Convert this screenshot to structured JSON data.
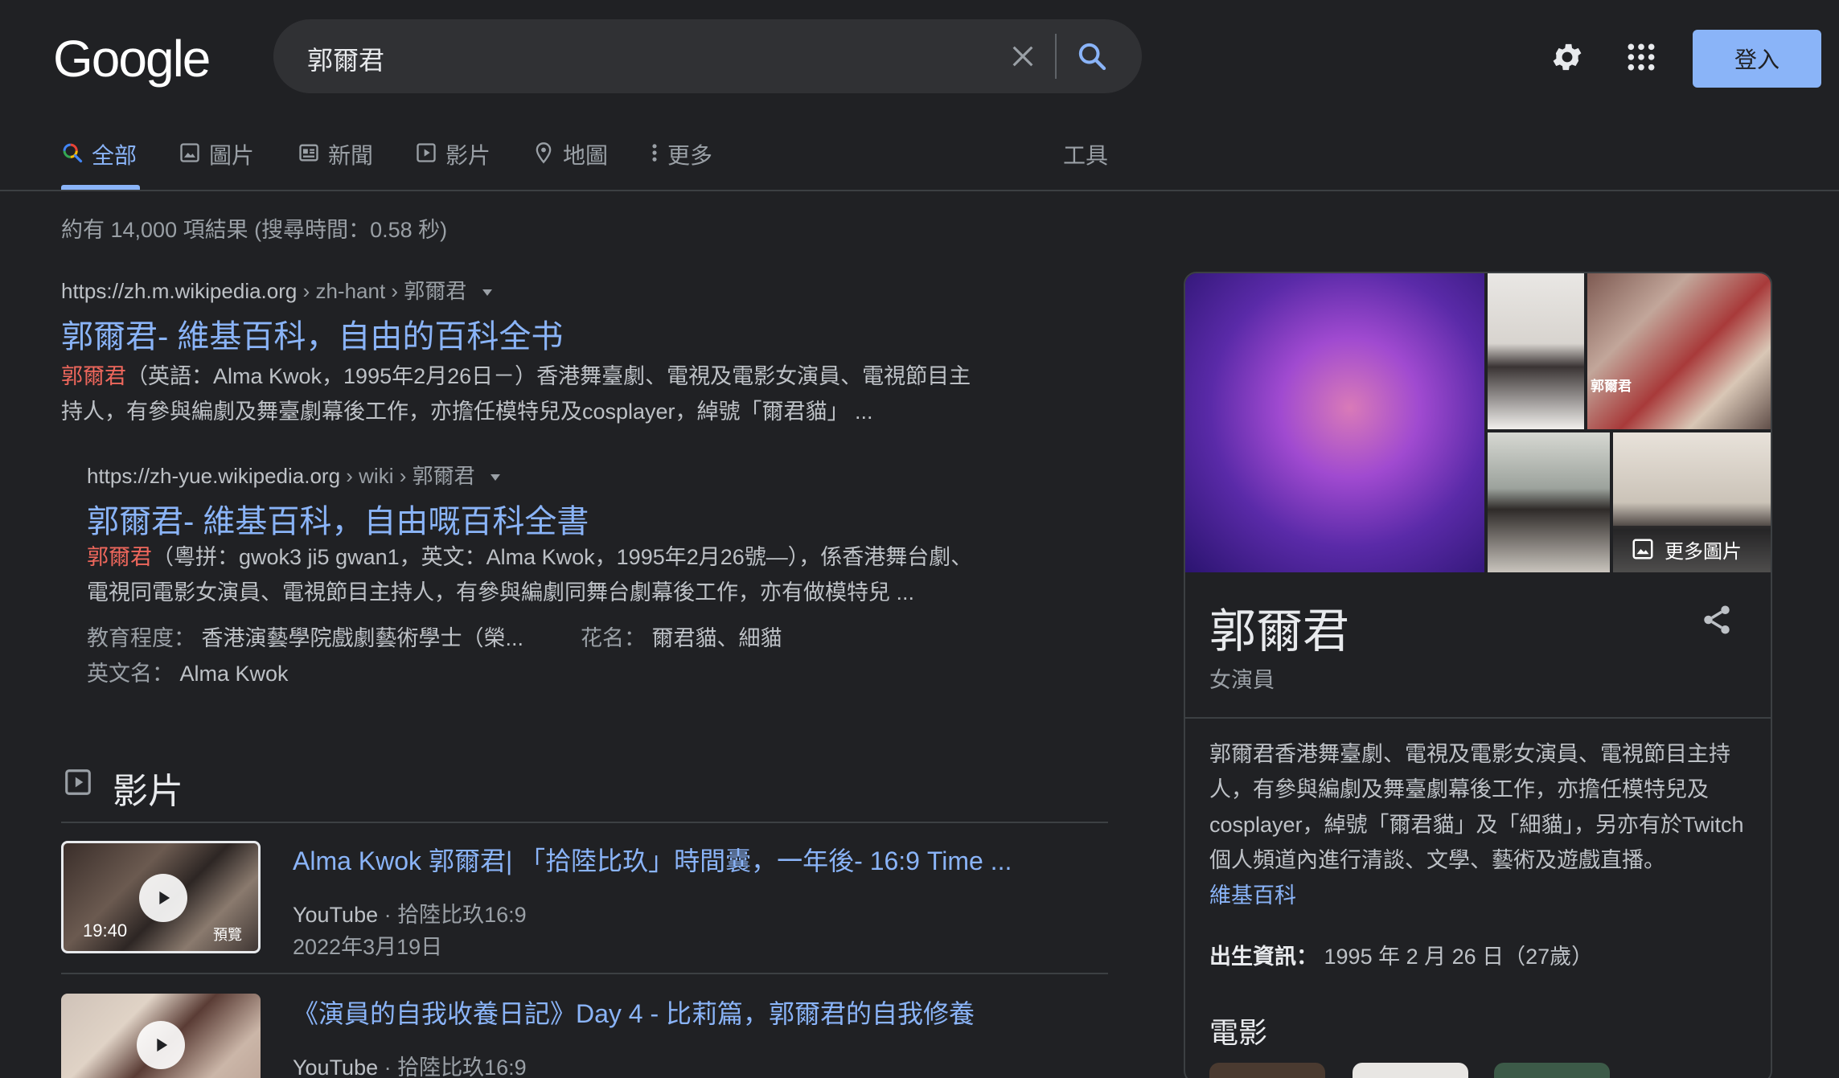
{
  "header": {
    "logo": "Google",
    "query": "郭爾君",
    "signin_label": "登入"
  },
  "tabs": {
    "all": "全部",
    "images": "圖片",
    "news": "新聞",
    "videos": "影片",
    "maps": "地圖",
    "more": "更多",
    "tools": "工具"
  },
  "result_stats": "約有 14,000 項結果 (搜尋時間：0.58 秒)",
  "results": [
    {
      "domain": "https://zh.m.wikipedia.org",
      "path": " › zh-hant › 郭爾君",
      "title": "郭爾君- 維基百科，自由的百科全书",
      "highlight": "郭爾君",
      "snippet_line1": "（英語：Alma Kwok，1995年2月26日－）香港舞臺劇、電視及電影女演員、電視節目主",
      "snippet_line2": "持人，有參與編劇及舞臺劇幕後工作，亦擔任模特兒及cosplayer，綽號「爾君貓」 ..."
    },
    {
      "domain": "https://zh-yue.wikipedia.org",
      "path": " › wiki › 郭爾君",
      "title": "郭爾君- 維基百科，自由嘅百科全書",
      "highlight": "郭爾君",
      "snippet_line1": "（粵拼：gwok3 ji5 gwan1，英文：Alma Kwok，1995年2月26號—），係香港舞台劇、",
      "snippet_line2": "電視同電影女演員、電視節目主持人，有參與編劇同舞台劇幕後工作，亦有做模特兒 ...",
      "meta": [
        {
          "label": "教育程度：",
          "value": "香港演藝學院戲劇藝術學士（榮..."
        },
        {
          "label": "花名：",
          "value": "爾君貓、細貓"
        },
        {
          "label": "英文名：",
          "value": "Alma Kwok"
        }
      ]
    }
  ],
  "videos": {
    "heading": "影片",
    "items": [
      {
        "title": "Alma Kwok 郭爾君| 「拾陸比玖」時間囊，一年後- 16:9 Time ...",
        "source": "YouTube",
        "channel": " · 拾陸比玖16:9",
        "date": "2022年3月19日",
        "duration": "19:40",
        "preview": "預覽"
      },
      {
        "title": "《演員的自我收養日記》Day 4 - 比莉篇，郭爾君的自我修養",
        "source": "YouTube",
        "channel": " · 拾陸比玖16:9"
      }
    ]
  },
  "knowledge_panel": {
    "name": "郭爾君",
    "subtitle": "女演員",
    "more_images": "更多圖片",
    "image_caption_1": "郭爾君",
    "description": "郭爾君香港舞臺劇、電視及電影女演員、電視節目主持人，有參與編劇及舞臺劇幕後工作，亦擔任模特兒及cosplayer，綽號「爾君貓」及「細貓」，另亦有於Twitch個人頻道內進行清談、文學、藝術及遊戲直播。",
    "source_link": "維基百科",
    "birth_label": "出生資訊：",
    "birth_value": "1995 年 2 月 26 日（27歲）",
    "films_heading": "電影"
  },
  "colors": {
    "background": "#202124",
    "link": "#8ab4f8",
    "highlight": "#ee675c",
    "signin_bg": "#8ab4f8"
  }
}
